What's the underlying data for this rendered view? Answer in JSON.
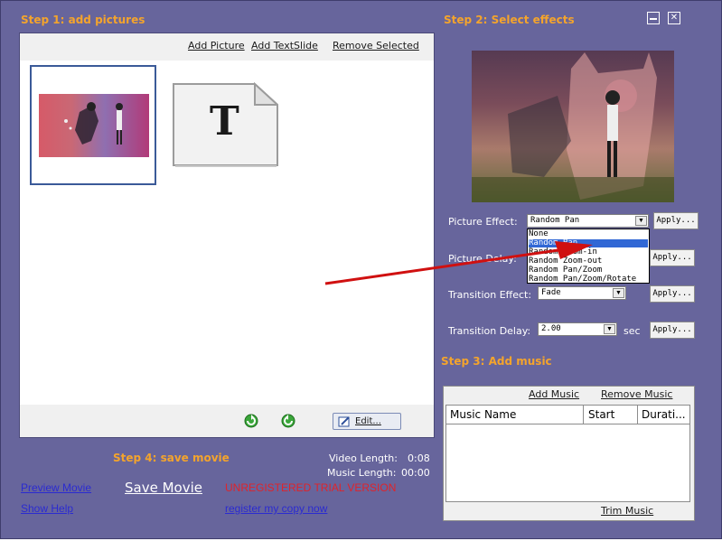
{
  "step1": {
    "title": "Step 1: add pictures",
    "add_picture": "Add Picture",
    "add_textslide": "Add TextSlide",
    "remove_selected": "Remove Selected",
    "textslide_glyph": "T",
    "edit_label": "Edit..."
  },
  "step2": {
    "title": "Step 2: Select effects",
    "picture_effect_label": "Picture Effect:",
    "picture_effect_value": "Random Pan",
    "effect_options": [
      "None",
      "Random Pan",
      "Random Zoom-in",
      "Random Zoom-out",
      "Random Pan/Zoom",
      "Random Pan/Zoom/Rotate"
    ],
    "picture_delay_label": "Picture Delay:",
    "transition_effect_label": "Transition Effect:",
    "transition_effect_value": "Fade",
    "transition_delay_label": "Transition Delay:",
    "transition_delay_value": "2.00",
    "sec": "sec",
    "apply": "Apply..."
  },
  "step3": {
    "title": "Step 3: Add music",
    "add_music": "Add Music",
    "remove_music": "Remove Music",
    "columns": [
      "Music Name",
      "Start",
      "Durati..."
    ],
    "trim_music": "Trim Music"
  },
  "step4": {
    "title": "Step 4: save movie",
    "video_length_label": "Video Length:",
    "video_length_value": "0:08",
    "music_length_label": "Music Length:",
    "music_length_value": "00:00",
    "preview_movie": "Preview Movie",
    "save_movie": "Save Movie",
    "unregistered": "UNREGISTERED TRIAL VERSION",
    "show_help": "Show Help",
    "register": "register my copy now"
  },
  "window_controls": {
    "minimize": "minimize-icon",
    "close": "close-icon"
  },
  "colors": {
    "background": "#67659c",
    "step_title": "#f4a42c",
    "link": "#2b2bd0",
    "warning": "#e0232a",
    "arrow": "#d01010",
    "selection": "#3168d5"
  }
}
